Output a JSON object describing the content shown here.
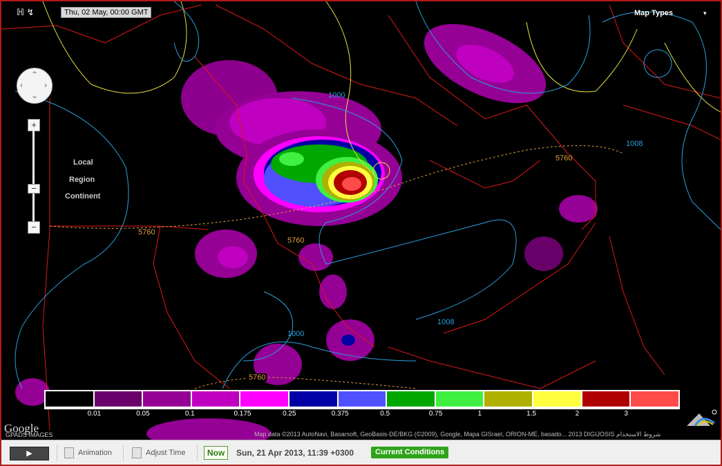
{
  "map": {
    "date_badge": "Thu, 02 May, 00:00 GMT",
    "map_types_label": "Map Types",
    "overlay_labels": [
      "Local",
      "Region",
      "Continent"
    ],
    "contour_labels": {
      "c1": "1000",
      "c2": "1008",
      "c3": "5760",
      "c4": "5760",
      "c5": "5760",
      "c6": "1008",
      "c7": "1000",
      "c8": "5760"
    },
    "zoom": {
      "plus": "+",
      "minus": "−"
    },
    "google_logo": "Google",
    "imagery_text": "GPADS IMAGES",
    "attribution": "Map data ©2013 AutoNavi, Basarsoft, GeoBasis-DE/BKG (©2009), Google, Mapa GISrael, ORION-ME, basado...  2013 DIGIJOSIS  شروط الاستخدام"
  },
  "legend": {
    "colors": [
      "#000000",
      "#6a006a",
      "#950095",
      "#c000c0",
      "#ff00ff",
      "#0000a5",
      "#5050ff",
      "#00a800",
      "#40f040",
      "#b0b000",
      "#ffff40",
      "#b00000",
      "#ff4a4a"
    ],
    "labels": [
      "0.01",
      "0.05",
      "0.1",
      "0.175",
      "0.25",
      "0.375",
      "0.5",
      "0.75",
      "1",
      "1.5",
      "2",
      "3"
    ]
  },
  "toolbar": {
    "play": "▶",
    "animation": "Animation",
    "adjust_time": "Adjust Time",
    "now": "Now",
    "clock": "Sun, 21 Apr 2013, 11:39 +0300",
    "current_conditions": "Current Conditions"
  }
}
